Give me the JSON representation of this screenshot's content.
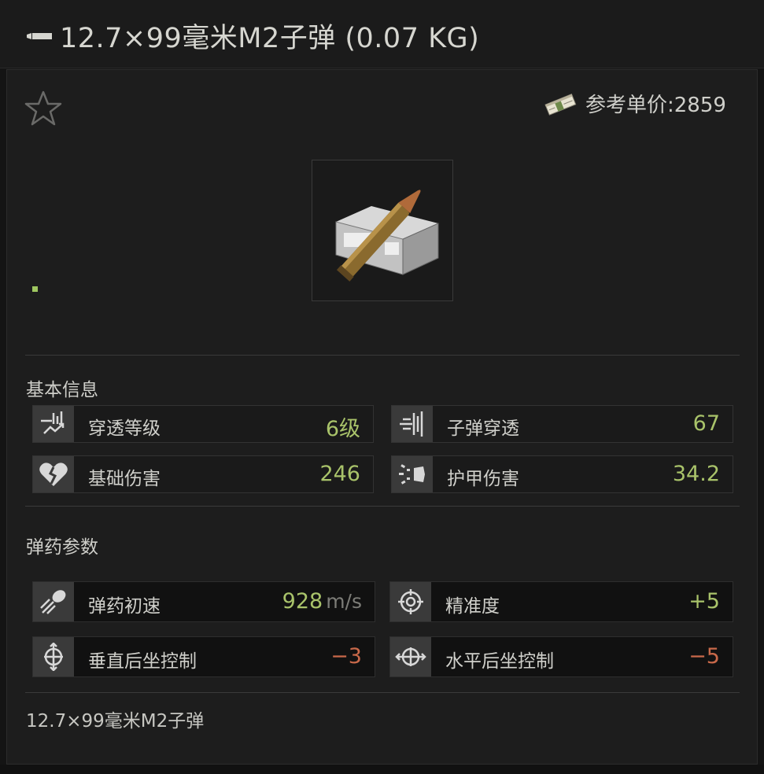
{
  "header": {
    "title": "12.7×99毫米M2子弹 (0.07 KG)"
  },
  "price": {
    "label": "参考单价:2859",
    "icon": "money-icon"
  },
  "sections": {
    "basic": {
      "title": "基本信息",
      "stats": [
        {
          "label": "穿透等级",
          "value": "6级",
          "icon": "penetration-level-icon"
        },
        {
          "label": "子弹穿透",
          "value": "67",
          "icon": "bullet-penetration-icon"
        },
        {
          "label": "基础伤害",
          "value": "246",
          "icon": "broken-heart-icon"
        },
        {
          "label": "护甲伤害",
          "value": "34.2",
          "icon": "armor-damage-icon"
        }
      ]
    },
    "ammo": {
      "title": "弹药参数",
      "stats": [
        {
          "label": "弹药初速",
          "value": "928",
          "unit": "m/s",
          "icon": "velocity-icon"
        },
        {
          "label": "精准度",
          "value": "+5",
          "icon": "crosshair-icon"
        },
        {
          "label": "垂直后坐控制",
          "value": "−3",
          "icon": "vertical-recoil-icon"
        },
        {
          "label": "水平后坐控制",
          "value": "−5",
          "icon": "horizontal-recoil-icon"
        }
      ]
    }
  },
  "footer": {
    "name": "12.7×99毫米M2子弹"
  },
  "colors": {
    "positive": "#a9c36a",
    "negative": "#c9694a",
    "accent": "#9fc760"
  }
}
